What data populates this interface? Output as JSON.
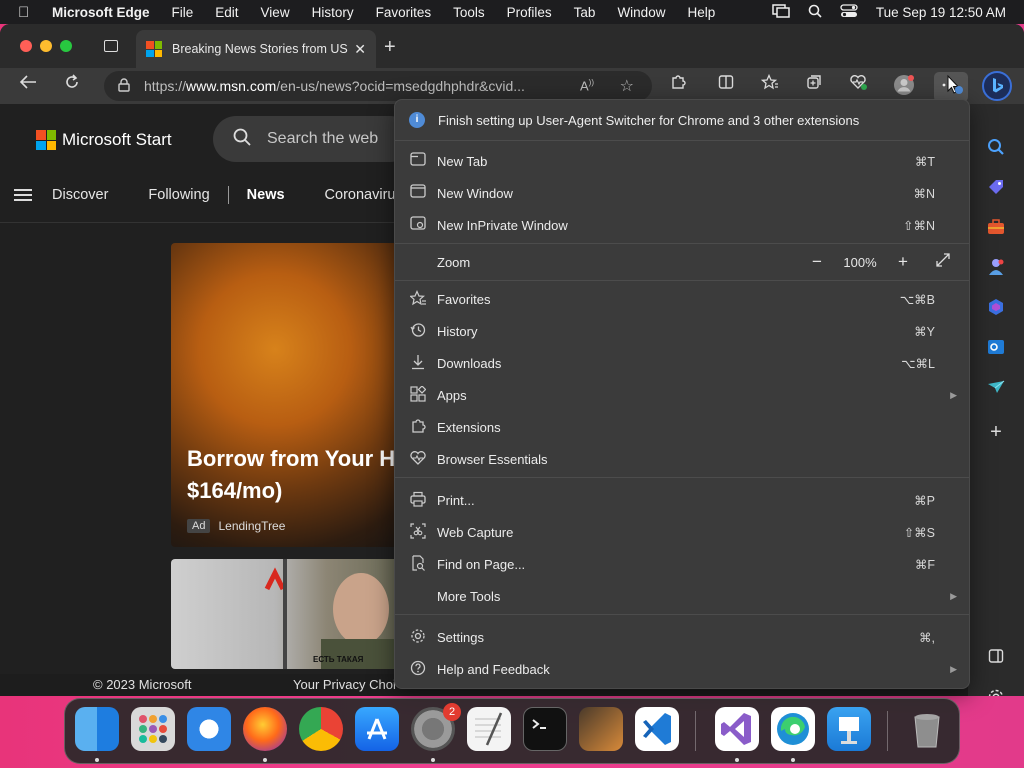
{
  "menubar": {
    "app_name": "Microsoft Edge",
    "items": [
      "File",
      "Edit",
      "View",
      "History",
      "Favorites",
      "Tools",
      "Profiles",
      "Tab",
      "Window",
      "Help"
    ],
    "clock": "Tue Sep 19  12:50 AM"
  },
  "tab": {
    "title": "Breaking News Stories from US"
  },
  "address": {
    "url_prefix": "https://",
    "url_domain": "www.msn.com",
    "url_rest": "/en-us/news?ocid=msedgdhphdr&cvid..."
  },
  "page": {
    "brand": "Microsoft Start",
    "search_placeholder": "Search the web",
    "nav": [
      "Discover",
      "Following",
      "News",
      "Coronavirus"
    ],
    "card1": {
      "headline": "Borrow from Your H $164/mo)",
      "ad_label": "Ad",
      "source": "LendingTree"
    },
    "card2_sign": "ЕСТЬ ТАКАЯ",
    "footer": {
      "copyright": "© 2023 Microsoft",
      "privacy": "Your Privacy Choi"
    }
  },
  "menu": {
    "banner": "Finish setting up User-Agent Switcher for Chrome and 3 other extensions",
    "new_tab": {
      "label": "New Tab",
      "shortcut": "⌘T"
    },
    "new_window": {
      "label": "New Window",
      "shortcut": "⌘N"
    },
    "new_inprivate": {
      "label": "New InPrivate Window",
      "shortcut": "⇧⌘N"
    },
    "zoom": {
      "label": "Zoom",
      "value": "100%"
    },
    "favorites": {
      "label": "Favorites",
      "shortcut": "⌥⌘B"
    },
    "history": {
      "label": "History",
      "shortcut": "⌘Y"
    },
    "downloads": {
      "label": "Downloads",
      "shortcut": "⌥⌘L"
    },
    "apps": {
      "label": "Apps"
    },
    "extensions": {
      "label": "Extensions"
    },
    "browser_essentials": {
      "label": "Browser Essentials"
    },
    "print": {
      "label": "Print...",
      "shortcut": "⌘P"
    },
    "web_capture": {
      "label": "Web Capture",
      "shortcut": "⇧⌘S"
    },
    "find": {
      "label": "Find on Page...",
      "shortcut": "⌘F"
    },
    "more_tools": {
      "label": "More Tools"
    },
    "settings": {
      "label": "Settings",
      "shortcut": "⌘,"
    },
    "help": {
      "label": "Help and Feedback"
    }
  },
  "dock": {
    "system_settings_badge": "2"
  },
  "colors": {
    "accent": "#4f8bd6",
    "menu_bg": "#3b3b3b",
    "desktop": "#e8347a"
  }
}
